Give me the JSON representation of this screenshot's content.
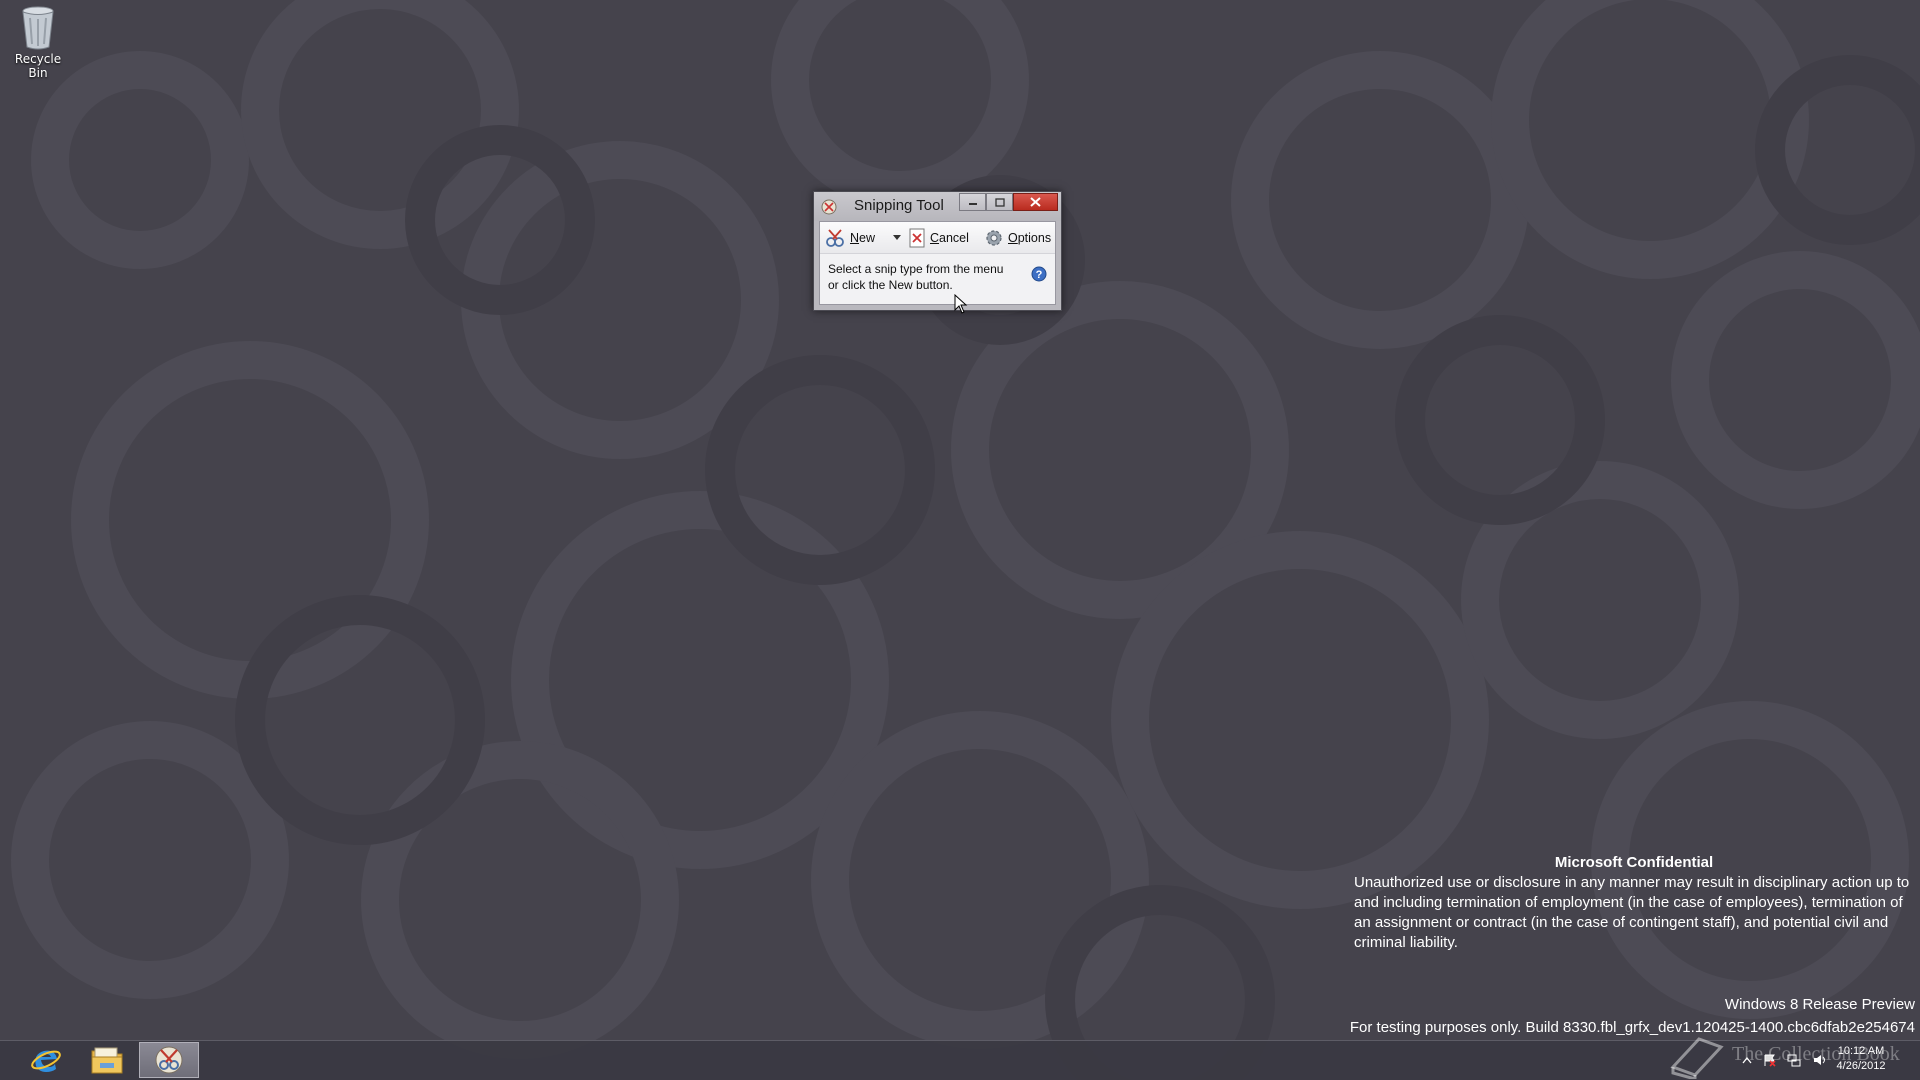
{
  "desktop": {
    "icons": [
      {
        "label": "Recycle Bin",
        "icon": "recycle-bin-icon"
      }
    ]
  },
  "watermark": {
    "title": "Microsoft Confidential",
    "body": "Unauthorized use or disclosure in any manner may result in disciplinary action up to and including termination of employment (in the case of employees), termination of an assignment or contract (in the case of contingent staff), and potential civil and criminal liability.",
    "product": "Windows 8 Release Preview",
    "build": "For testing purposes only. Build 8330.fbl_grfx_dev1.120425-1400.cbc6dfab2e254674"
  },
  "snipping_tool": {
    "title": "Snipping Tool",
    "toolbar": {
      "new_label": "New",
      "cancel_label": "Cancel",
      "options_label": "Options"
    },
    "message": "Select a snip type from the menu or click the New button."
  },
  "taskbar": {
    "items": [
      {
        "name": "Internet Explorer",
        "icon": "internet-explorer-icon"
      },
      {
        "name": "File Explorer",
        "icon": "file-explorer-icon"
      },
      {
        "name": "Snipping Tool",
        "icon": "snipping-tool-icon",
        "active": true
      }
    ],
    "overlay_text": "The Collection Book",
    "clock": {
      "time": "10:12 AM",
      "date": "4/26/2012"
    }
  },
  "colors": {
    "desktop_bg": "#45434c",
    "close_button": "#c8382c",
    "window_frame": "#b9b8be"
  }
}
